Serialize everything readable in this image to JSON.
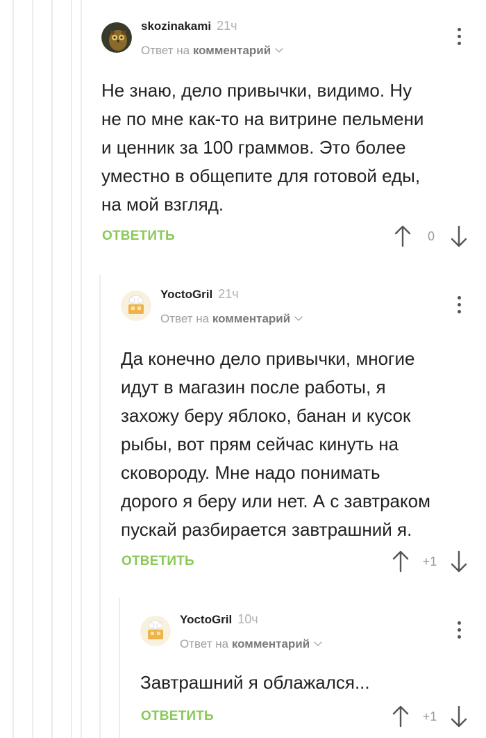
{
  "comments": [
    {
      "author": "skozinakami",
      "time": "21ч",
      "reply_prefix": "Ответ на",
      "reply_target": "комментарий",
      "text": "Не знаю, дело привычки, видимо. Ну\nне по мне как-то на витрине пельмени\nи ценник за 100 граммов. Это более\nуместно в общепите для готовой еды,\nна мой взгляд.",
      "reply_label": "ОТВЕТИТЬ",
      "score": "0",
      "avatar_icon": "owl-avatar-icon"
    },
    {
      "author": "YoctoGril",
      "time": "21ч",
      "reply_prefix": "Ответ на",
      "reply_target": "комментарий",
      "text": "Да конечно дело привычки, многие\nидут в магазин после работы,  я\nзахожу беру  яблоко, банан и кусок\nрыбы, вот прям сейчас кинуть на\nсковороду. Мне надо понимать\nдорого я беру или нет. А с завтраком\nпускай разбирается завтрашний я.",
      "reply_label": "ОТВЕТИТЬ",
      "score": "+1",
      "avatar_icon": "chef-avatar-icon"
    },
    {
      "author": "YoctoGril",
      "time": "10ч",
      "reply_prefix": "Ответ на",
      "reply_target": "комментарий",
      "text": "Завтрашний я облажался...",
      "reply_label": "ОТВЕТИТЬ",
      "score": "+1",
      "avatar_icon": "chef-avatar-icon"
    }
  ],
  "colors": {
    "accent_green": "#8ac858",
    "thread_line": "#ececec"
  }
}
